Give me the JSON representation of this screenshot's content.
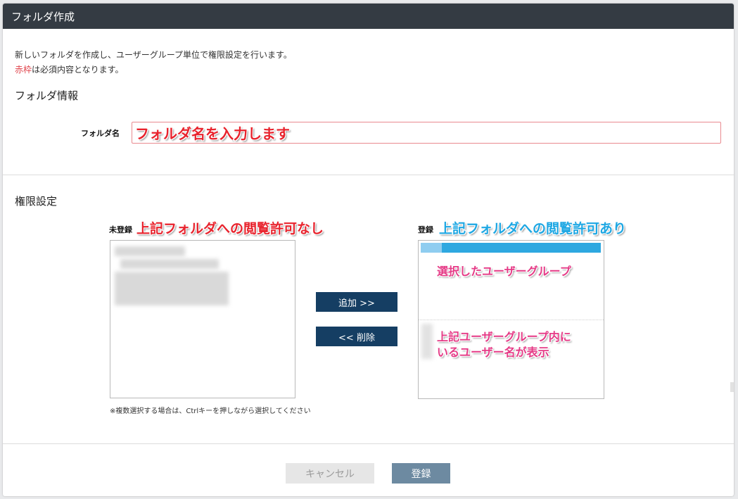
{
  "dialog": {
    "title": "フォルダ作成",
    "description": "新しいフォルダを作成し、ユーザーグループ単位で権限設定を行います。",
    "required_note_red": "赤枠",
    "required_note_rest": "は必須内容となります。"
  },
  "folder_info": {
    "section_title": "フォルダ情報",
    "name_label": "フォルダ名",
    "name_value": "",
    "annotation": "フォルダ名を入力します"
  },
  "permissions": {
    "section_title": "権限設定",
    "unregistered_label": "未登録",
    "unregistered_annotation": "上記フォルダへの閲覧許可なし",
    "registered_label": "登録",
    "registered_annotation": "上記フォルダへの閲覧許可あり",
    "selected_group_annotation": "選択したユーザーグループ",
    "members_annotation_line1": "上記ユーザーグループ内に",
    "members_annotation_line2": "いるユーザー名が表示",
    "add_button": "追加 >>",
    "remove_button": "<< 削除",
    "hint": "※複数選択する場合は、Ctrlキーを押しながら選択してください"
  },
  "footer": {
    "cancel_button": "キャンセル",
    "submit_button": "登録"
  },
  "colors": {
    "titlebar": "#343b43",
    "required_red": "#e0454d",
    "button_dark": "#153e63",
    "selection_blue": "#2ea8e0"
  }
}
